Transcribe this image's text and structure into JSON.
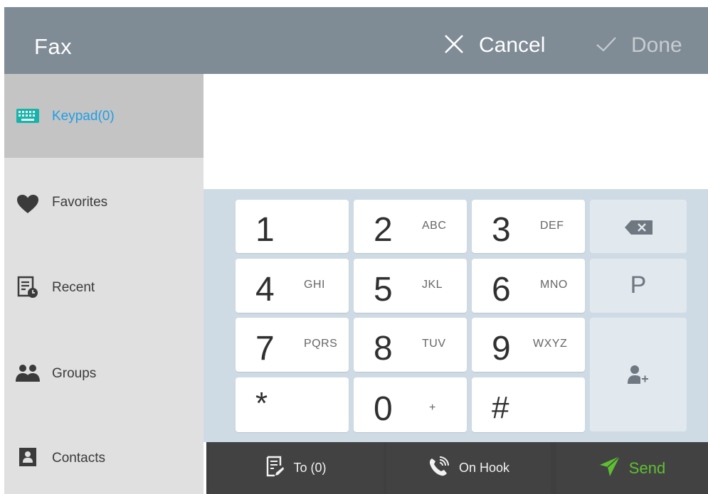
{
  "header": {
    "title": "Fax",
    "cancel_label": "Cancel",
    "done_label": "Done"
  },
  "sidebar": {
    "items": [
      {
        "label": "Keypad(0)",
        "icon": "keyboard-icon",
        "active": true
      },
      {
        "label": "Favorites",
        "icon": "heart-icon"
      },
      {
        "label": "Recent",
        "icon": "recent-list-icon"
      },
      {
        "label": "Groups",
        "icon": "people-icon"
      },
      {
        "label": "Contacts",
        "icon": "contact-card-icon"
      }
    ]
  },
  "keypad": {
    "keys": [
      {
        "digit": "1",
        "letters": ""
      },
      {
        "digit": "2",
        "letters": "ABC"
      },
      {
        "digit": "3",
        "letters": "DEF"
      },
      {
        "digit": "4",
        "letters": "GHI"
      },
      {
        "digit": "5",
        "letters": "JKL"
      },
      {
        "digit": "6",
        "letters": "MNO"
      },
      {
        "digit": "7",
        "letters": "PQRS"
      },
      {
        "digit": "8",
        "letters": "TUV"
      },
      {
        "digit": "9",
        "letters": "WXYZ"
      },
      {
        "digit": "*",
        "letters": ""
      },
      {
        "digit": "0",
        "letters": "+"
      },
      {
        "digit": "#",
        "letters": ""
      }
    ],
    "pause_label": "P"
  },
  "bottombar": {
    "to_label": "To (0)",
    "onhook_label": "On Hook",
    "send_label": "Send"
  },
  "colors": {
    "header_bg": "#7f8b95",
    "accent_blue": "#1e9ee6",
    "send_green": "#5fbf32",
    "keypad_bg": "#cfdbe4"
  }
}
